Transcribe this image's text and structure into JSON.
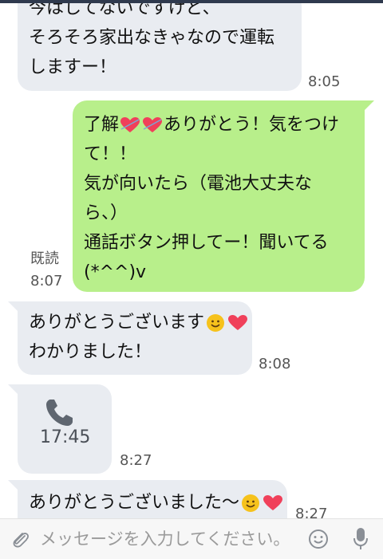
{
  "messages": {
    "m1": {
      "lines": [
        "今はしてないですけど、",
        "そろそろ家出なきゃなので運転",
        "しますー！"
      ],
      "time": "8:05"
    },
    "m2": {
      "line1_a": "了解",
      "line1_b": "ありがとう！気をつけ",
      "lines": [
        "て！！",
        "気が向いたら（電池大丈夫な",
        "ら、）",
        "通話ボタン押してー！聞いてる",
        "(*^^)v"
      ],
      "read_label": "既読",
      "time": "8:07"
    },
    "m3": {
      "line1": "ありがとうございます",
      "line2": "わかりました！",
      "time": "8:08"
    },
    "m4": {
      "call_duration": "17:45",
      "time": "8:27"
    },
    "m5": {
      "line1": "ありがとうございました〜",
      "time": "8:27"
    }
  },
  "input": {
    "placeholder": "メッセージを入力してください。"
  },
  "colors": {
    "incoming": "#e9ecf1",
    "outgoing": "#b8ef8b",
    "heart": "#f0405a",
    "smile": "#f6c21c"
  },
  "icons": [
    "phone-icon",
    "heart-icon",
    "smile-icon",
    "paperclip-icon",
    "emoji-icon",
    "microphone-icon"
  ]
}
